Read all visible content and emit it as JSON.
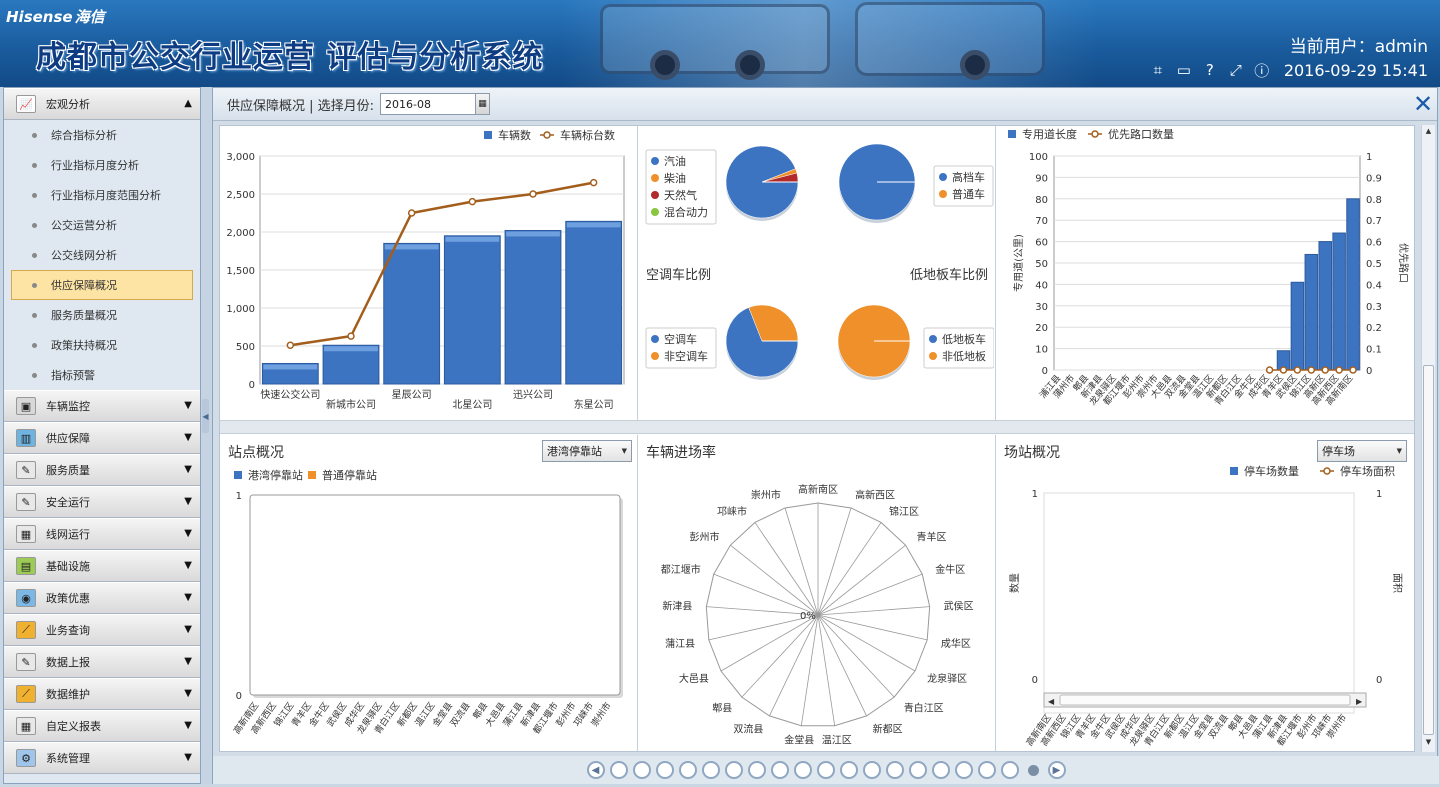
{
  "header": {
    "logo_en": "Hisense",
    "logo_cn": "海信",
    "title": "成都市公交行业运营 评估与分析系统",
    "user_label": "当前用户：admin",
    "datetime": "2016-09-29 15:41"
  },
  "sidebar": {
    "groups": [
      {
        "label": "宏观分析",
        "icon": "chart-line-icon",
        "expanded": true,
        "items": [
          "综合指标分析",
          "行业指标月度分析",
          "行业指标月度范围分析",
          "公交运营分析",
          "公交线网分析",
          "供应保障概况",
          "服务质量概况",
          "政策扶持概况",
          "指标预警"
        ],
        "active": "供应保障概况"
      },
      {
        "label": "车辆监控",
        "icon": "monitor-icon"
      },
      {
        "label": "供应保障",
        "icon": "supply-icon"
      },
      {
        "label": "服务质量",
        "icon": "pencil-icon"
      },
      {
        "label": "安全运行",
        "icon": "pencil-icon"
      },
      {
        "label": "线网运行",
        "icon": "calendar-icon"
      },
      {
        "label": "基础设施",
        "icon": "facility-icon"
      },
      {
        "label": "政策优惠",
        "icon": "policy-icon"
      },
      {
        "label": "业务查询",
        "icon": "trend-icon"
      },
      {
        "label": "数据上报",
        "icon": "pencil-icon"
      },
      {
        "label": "数据维护",
        "icon": "trend-icon"
      },
      {
        "label": "自定义报表",
        "icon": "calendar-icon"
      },
      {
        "label": "系统管理",
        "icon": "gear-icon"
      }
    ]
  },
  "main": {
    "breadcrumb": "供应保障概况 | 选择月份:",
    "month_value": "2016-08"
  },
  "panel_labels": {
    "aircon_title": "空调车比例",
    "lowfloor_title": "低地板车比例",
    "stop_title": "站点概况",
    "stop_select": "港湾停靠站",
    "entry_title": "车辆进场率",
    "yard_title": "场站概况",
    "yard_select": "停车场"
  },
  "chart_data": [
    {
      "type": "bar",
      "categories": [
        "快速公交公司",
        "新城市公司",
        "星辰公司",
        "北星公司",
        "迅兴公司",
        "东星公司"
      ],
      "series": [
        {
          "name": "车辆数",
          "type": "bar",
          "values": [
            270,
            510,
            1850,
            1950,
            2020,
            2140
          ],
          "color": "#3d74c2"
        },
        {
          "name": "车辆标台数",
          "type": "line",
          "values": [
            510,
            630,
            2250,
            2400,
            2500,
            2650
          ],
          "color": "#a35e1c"
        }
      ],
      "ylim": [
        0,
        3000
      ],
      "yticks": [
        0,
        500,
        1000,
        1500,
        2000,
        2500,
        3000
      ]
    },
    {
      "type": "pie",
      "legend": [
        "汽油",
        "柴油",
        "天然气",
        "混合动力"
      ],
      "values": [
        94,
        2,
        4,
        0
      ],
      "colors": [
        "#3d74c2",
        "#f0902a",
        "#b22a2a",
        "#8ac640"
      ]
    },
    {
      "type": "pie",
      "legend": [
        "高档车",
        "普通车"
      ],
      "values": [
        100,
        0
      ],
      "colors": [
        "#3d74c2",
        "#f0902a"
      ]
    },
    {
      "type": "pie",
      "legend": [
        "空调车",
        "非空调车"
      ],
      "values": [
        69,
        31
      ],
      "colors": [
        "#3d74c2",
        "#f0902a"
      ]
    },
    {
      "type": "pie",
      "legend": [
        "低地板车",
        "非低地板"
      ],
      "values": [
        0,
        100
      ],
      "colors": [
        "#3d74c2",
        "#f0902a"
      ]
    },
    {
      "type": "bar",
      "categories": [
        "浦江县",
        "蒲州市",
        "郫县",
        "新津县",
        "龙泉驿区",
        "都江堰市",
        "彭州市",
        "崇州市",
        "大邑县",
        "双流县",
        "金堂县",
        "温江区",
        "新都区",
        "青白江区",
        "金牛区",
        "成华区",
        "青羊区",
        "武侯区",
        "锦江区",
        "高新区",
        "高新西区",
        "高新南区"
      ],
      "series": [
        {
          "name": "专用道长度",
          "type": "bar",
          "values": [
            0,
            0,
            0,
            0,
            0,
            0,
            0,
            0,
            0,
            0,
            0,
            0,
            0,
            0,
            0,
            0,
            9,
            41,
            54,
            60,
            64,
            80
          ],
          "color": "#3d74c2"
        },
        {
          "name": "优先路口数量",
          "type": "line",
          "values": [
            0,
            0,
            0,
            0,
            0,
            0,
            0,
            0,
            0,
            0,
            0,
            0,
            0,
            0,
            0,
            0,
            0,
            0,
            0,
            0,
            0,
            0
          ],
          "color": "#a35e1c"
        }
      ],
      "ylabel": "专用道(公里)",
      "y2label": "优先路口",
      "ylim": [
        0,
        100
      ],
      "yticks": [
        0,
        10,
        20,
        30,
        40,
        50,
        60,
        70,
        80,
        90,
        100
      ],
      "y2ticks": [
        0,
        0.1,
        0.2,
        0.3,
        0.4,
        0.5,
        0.6,
        0.7,
        0.8,
        0.9,
        1
      ]
    },
    {
      "type": "bar",
      "categories": [
        "高新南区",
        "高新西区",
        "锦江区",
        "青羊区",
        "金牛区",
        "武侯区",
        "成华区",
        "龙泉驿区",
        "青白江区",
        "新都区",
        "温江区",
        "金堂县",
        "双流县",
        "郫县",
        "大邑县",
        "蒲江县",
        "新津县",
        "都江堰市",
        "彭州市",
        "邛崃市",
        "崇州市"
      ],
      "series": [
        {
          "name": "港湾停靠站",
          "values": [],
          "color": "#3d74c2"
        },
        {
          "name": "普通停靠站",
          "values": [],
          "color": "#f0902a"
        }
      ],
      "yticks": [
        0,
        1
      ]
    },
    {
      "type": "radar",
      "categories": [
        "高新南区",
        "高新西区",
        "锦江区",
        "青羊区",
        "金牛区",
        "武侯区",
        "成华区",
        "龙泉驿区",
        "青白江区",
        "新都区",
        "温江区",
        "金堂县",
        "双流县",
        "郫县",
        "大邑县",
        "蒲江县",
        "新津县",
        "都江堰市",
        "彭州市",
        "邛崃市",
        "崇州市"
      ],
      "center_label": "0%",
      "values": [
        0,
        0,
        0,
        0,
        0,
        0,
        0,
        0,
        0,
        0,
        0,
        0,
        0,
        0,
        0,
        0,
        0,
        0,
        0,
        0,
        0
      ]
    },
    {
      "type": "bar",
      "categories": [
        "高新南区",
        "高新西区",
        "锦江区",
        "青羊区",
        "金牛区",
        "武侯区",
        "成华区",
        "龙泉驿区",
        "青白江区",
        "新都区",
        "温江区",
        "金堂县",
        "双流县",
        "郫县",
        "大邑县",
        "蒲江县",
        "新津县",
        "都江堰市",
        "彭州市",
        "邛崃市",
        "崇州市"
      ],
      "series": [
        {
          "name": "停车场数量",
          "type": "bar",
          "values": [],
          "color": "#3d74c2"
        },
        {
          "name": "停车场面积",
          "type": "line",
          "values": [],
          "color": "#a35e1c"
        }
      ],
      "ylabel": "数量",
      "y2label": "面积",
      "yticks": [
        0,
        1
      ],
      "y2ticks": [
        0,
        1
      ]
    }
  ]
}
